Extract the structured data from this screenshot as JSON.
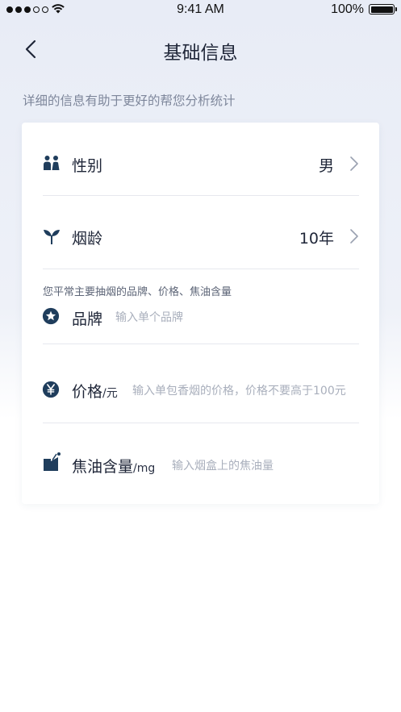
{
  "status": {
    "time": "9:41 AM",
    "battery": "100%"
  },
  "nav": {
    "title": "基础信息"
  },
  "subtitle": "详细的信息有助于更好的帮您分析统计",
  "form": {
    "gender": {
      "label": "性别",
      "value": "男",
      "icon": "people-icon"
    },
    "smoking_years": {
      "label": "烟龄",
      "value": "10年",
      "icon": "sprout-icon"
    },
    "brand_hint": "您平常主要抽烟的品牌、价格、焦油含量",
    "brand": {
      "label": "品牌",
      "placeholder": "输入单个品牌",
      "icon": "star-icon"
    },
    "price": {
      "label": "价格",
      "unit": "/元",
      "placeholder": "输入单包香烟的价格，价格不要高于100元",
      "icon": "yen-icon"
    },
    "tar": {
      "label": "焦油含量",
      "unit": "/mg",
      "placeholder": "输入烟盒上的焦油量",
      "icon": "tar-icon"
    }
  },
  "colors": {
    "accent": "#1f3d5c",
    "text": "#1f2638",
    "muted": "#7e879b",
    "placeholder": "#a9afbc"
  }
}
